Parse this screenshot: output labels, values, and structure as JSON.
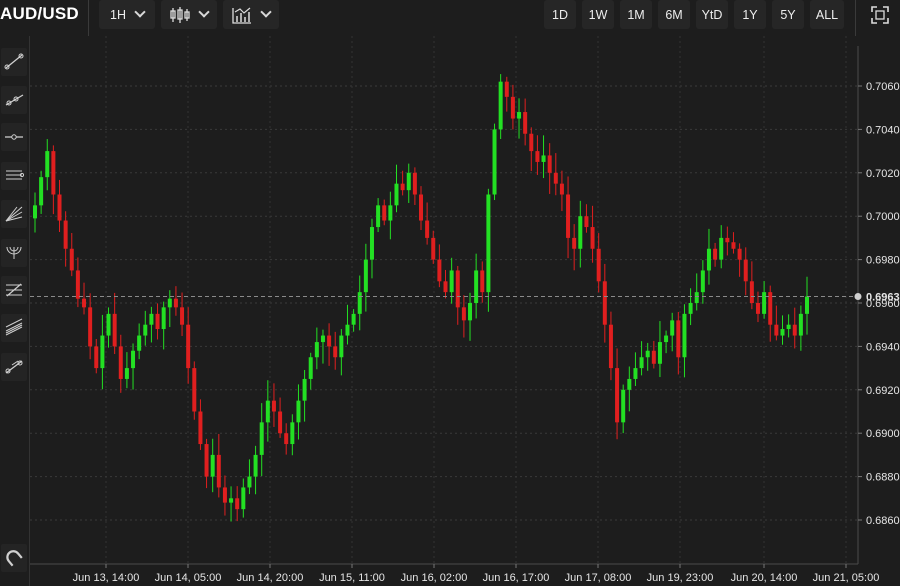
{
  "header": {
    "symbol": "AUD/USD",
    "interval": "1H",
    "chart_style_icon": "candlestick-icon",
    "indicators_icon": "indicator-chart-icon",
    "ranges": [
      "1D",
      "1W",
      "1M",
      "6M",
      "YtD",
      "1Y",
      "5Y",
      "ALL"
    ],
    "fullscreen_icon": "fullscreen-icon"
  },
  "tools": [
    "trend-line-icon",
    "ray-line-icon",
    "horizontal-line-icon",
    "parallel-channel-icon",
    "fan-lines-icon",
    "fibonacci-arc-icon",
    "fibonacci-retracement-icon",
    "fibonacci-channel-icon",
    "pitchfork-icon",
    "magnet-icon"
  ],
  "colors": {
    "up": "#23e023",
    "down": "#e01f1f",
    "background": "#1d1d1d",
    "grid": "#333333",
    "crosshair": "#8a8a8a"
  },
  "chart_data": {
    "type": "candlestick",
    "instrument": "AUD/USD",
    "interval": "1H",
    "grid": true,
    "ylim": [
      0.685,
      0.707
    ],
    "y_ticks": [
      "0.6860",
      "0.6880",
      "0.6900",
      "0.6920",
      "0.6940",
      "0.6960",
      "0.6980",
      "0.7000",
      "0.7020",
      "0.7040",
      "0.7060"
    ],
    "x_ticks": [
      "Jun 13, 14:00",
      "Jun 14, 05:00",
      "Jun 14, 20:00",
      "Jun 15, 11:00",
      "Jun 16, 02:00",
      "Jun 16, 17:00",
      "Jun 17, 08:00",
      "Jun 19, 23:00",
      "Jun 20, 14:00",
      "Jun 21, 05:00"
    ],
    "last_price": "0.6963",
    "close_path": [
      0.7005,
      0.7018,
      0.703,
      0.701,
      0.6998,
      0.6985,
      0.6975,
      0.6962,
      0.6958,
      0.694,
      0.693,
      0.6945,
      0.6955,
      0.694,
      0.6925,
      0.693,
      0.6938,
      0.6945,
      0.695,
      0.6955,
      0.6948,
      0.6958,
      0.6962,
      0.6958,
      0.695,
      0.693,
      0.691,
      0.6895,
      0.688,
      0.689,
      0.6875,
      0.6868,
      0.687,
      0.6865,
      0.6875,
      0.688,
      0.689,
      0.6905,
      0.6915,
      0.691,
      0.69,
      0.6895,
      0.6905,
      0.6915,
      0.6925,
      0.6935,
      0.6942,
      0.6945,
      0.694,
      0.6935,
      0.6945,
      0.695,
      0.6955,
      0.6965,
      0.698,
      0.6995,
      0.7005,
      0.6998,
      0.7005,
      0.7015,
      0.7012,
      0.702,
      0.701,
      0.6998,
      0.699,
      0.698,
      0.697,
      0.6965,
      0.6975,
      0.6958,
      0.6952,
      0.696,
      0.6975,
      0.6965,
      0.701,
      0.704,
      0.7062,
      0.7055,
      0.7045,
      0.7048,
      0.7038,
      0.703,
      0.7025,
      0.7028,
      0.702,
      0.7015,
      0.701,
      0.699,
      0.6985,
      0.7,
      0.6995,
      0.6985,
      0.697,
      0.695,
      0.693,
      0.6905,
      0.692,
      0.6925,
      0.693,
      0.6935,
      0.6938,
      0.6932,
      0.6942,
      0.6945,
      0.6952,
      0.6935,
      0.6955,
      0.696,
      0.6965,
      0.6975,
      0.6985,
      0.698,
      0.699,
      0.6988,
      0.6985,
      0.698,
      0.697,
      0.696,
      0.6955,
      0.6965,
      0.695,
      0.6945,
      0.6948,
      0.695,
      0.6945,
      0.6955,
      0.6963
    ]
  }
}
